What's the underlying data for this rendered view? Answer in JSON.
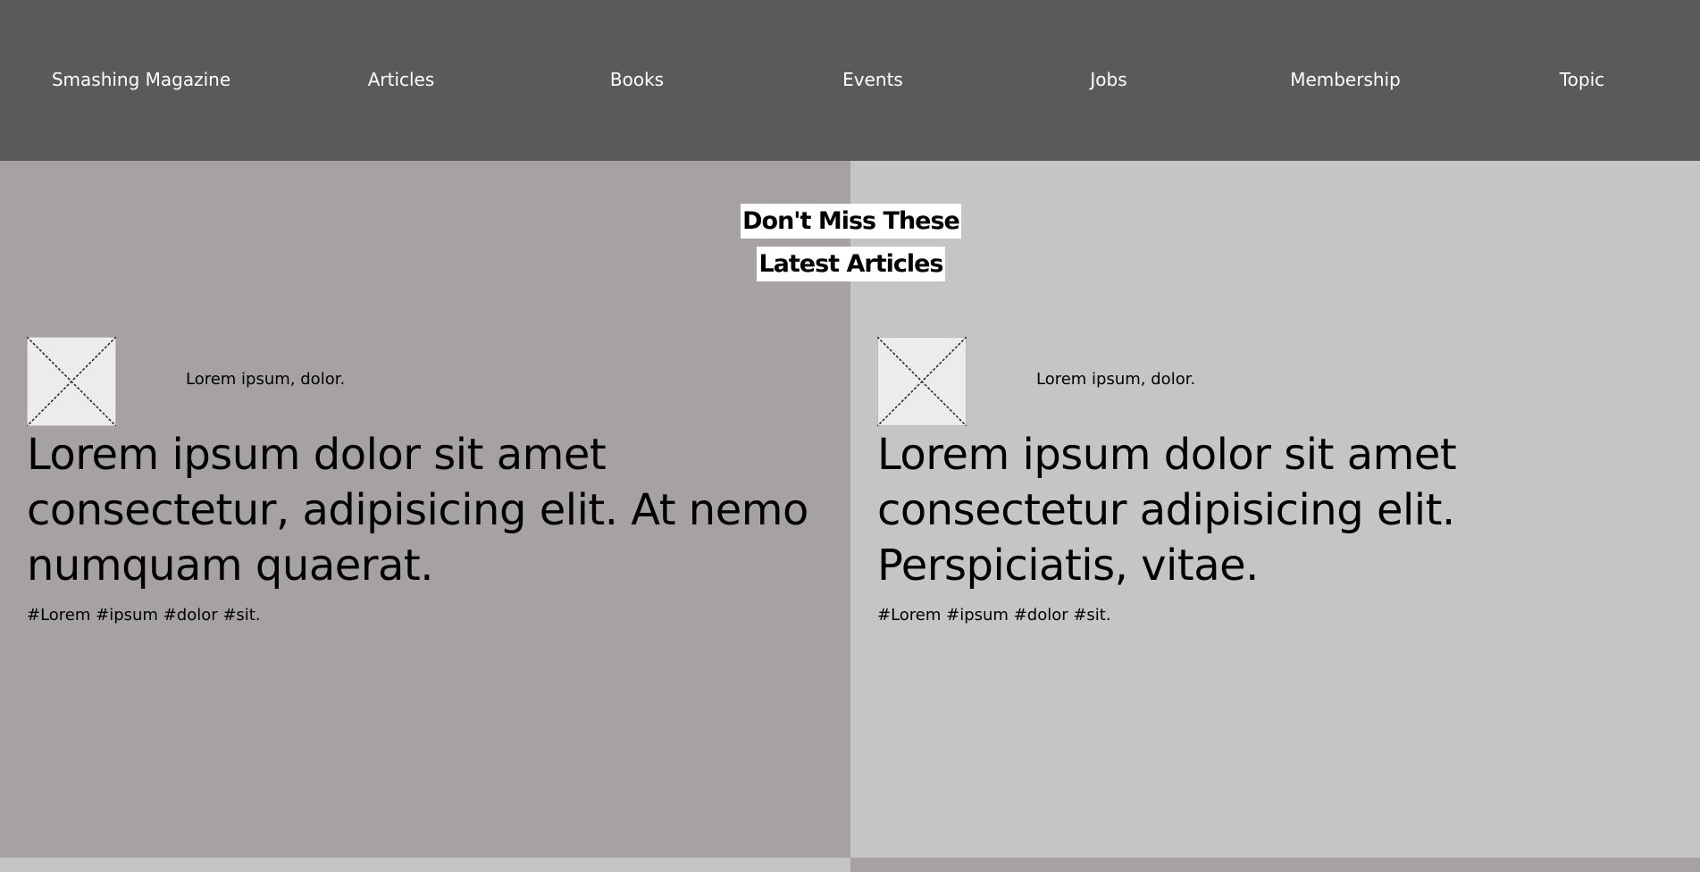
{
  "nav": {
    "brand": "Smashing Magazine",
    "items": [
      {
        "label": "Articles"
      },
      {
        "label": "Books"
      },
      {
        "label": "Events"
      },
      {
        "label": "Jobs"
      },
      {
        "label": "Membership"
      },
      {
        "label": "Topic"
      }
    ]
  },
  "section": {
    "title": "Don't Miss These Latest Articles"
  },
  "articles": [
    {
      "byline": "Lorem ipsum, dolor.",
      "headline": "Lorem ipsum dolor sit amet consectetur, adipisicing elit. At nemo numquam quaerat.",
      "tags": "#Lorem #ipsum #dolor #sit.",
      "image_icon": "broken-image-placeholder-icon"
    },
    {
      "byline": "Lorem ipsum, dolor.",
      "headline": "Lorem ipsum dolor sit amet consectetur adipisicing elit. Perspiciatis, vitae.",
      "tags": "#Lorem #ipsum #dolor #sit.",
      "image_icon": "broken-image-placeholder-icon"
    }
  ],
  "colors": {
    "nav_bg": "#5a5a5a",
    "panel_dark": "#a5a2a1",
    "panel_light": "#c5c5c5",
    "title_bg": "#ffffff"
  }
}
